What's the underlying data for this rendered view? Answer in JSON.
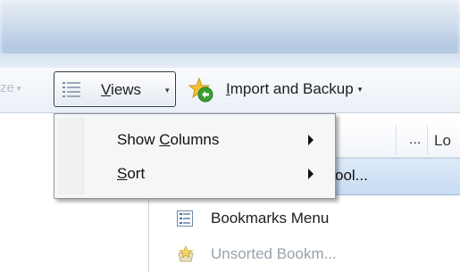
{
  "toolbar": {
    "organize_fragment": "ze",
    "views_label_underlined": "V",
    "views_label_rest": "iews",
    "import_label_underlined": "I",
    "import_label_rest": "mport and Backup",
    "icons": {
      "views": "list-view-icon",
      "import": "import-backup-star-icon",
      "dropdown": "chevron-down-icon"
    }
  },
  "columns": {
    "ellipsis": "...",
    "location_fragment": "Lo"
  },
  "rows": [
    {
      "label": "ool...",
      "selected": true
    },
    {
      "label": "Bookmarks Menu",
      "icon": "bookmarks-menu-icon",
      "selected": false
    },
    {
      "label": "Unsorted Bookm...",
      "icon": "unsorted-bookmarks-icon",
      "selected": false,
      "faded": true
    }
  ],
  "menu": {
    "items": [
      {
        "label_before": "Show ",
        "label_underlined": "C",
        "label_after": "olumns",
        "has_submenu": true
      },
      {
        "label_before": "",
        "label_underlined": "S",
        "label_after": "ort",
        "has_submenu": true
      }
    ]
  },
  "colors": {
    "accent_selected_row": "#c8dcf3",
    "menu_background": "#f5f6f7",
    "menu_border": "#979797"
  }
}
